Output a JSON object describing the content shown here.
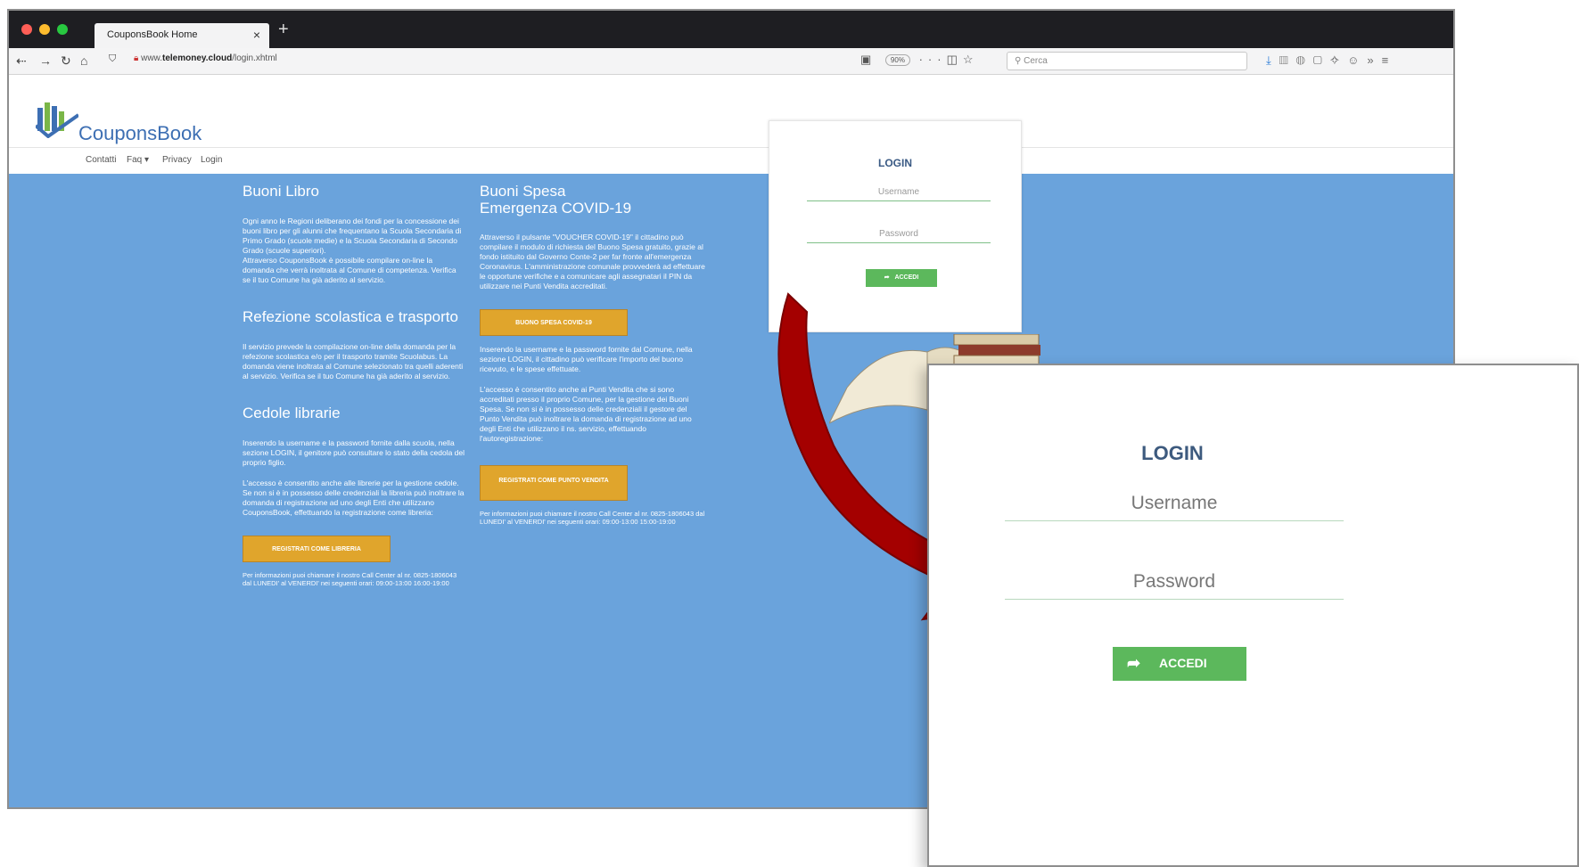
{
  "browser": {
    "tab_title": "CouponsBook Home",
    "tab_close": "×",
    "new_tab": "+",
    "url_prefix": "www.",
    "url_domain": "telemoney.cloud",
    "url_path": "/login.xhtml",
    "zoom": "90%",
    "search_placeholder": "Cerca"
  },
  "site": {
    "logo_text": "CouponsBook",
    "menu": [
      "Contatti",
      "Faq ▾",
      "Privacy",
      "Login"
    ]
  },
  "left_column": {
    "section1_title": "Buoni Libro",
    "section1_text": "Ogni anno le Regioni deliberano dei fondi per la concessione dei buoni libro per gli alunni che frequentano la Scuola Secondaria di Primo Grado (scuole medie) e la Scuola Secondaria di Secondo Grado (scuole superiori).\nAttraverso CouponsBook è possibile compilare on-line la domanda che verrà inoltrata al Comune di competenza. Verifica se il tuo Comune ha già aderito al servizio.",
    "section2_title": "Refezione scolastica e trasporto",
    "section2_text": "Il servizio prevede la compilazione on-line della domanda per la refezione scolastica e/o per il trasporto tramite Scuolabus. La domanda viene inoltrata al Comune selezionato tra quelli aderenti al servizio. Verifica se il tuo Comune ha già aderito al servizio.",
    "section3_title": "Cedole librarie",
    "section3_text1": "Inserendo la username e la password fornite dalla scuola, nella sezione LOGIN, il genitore può consultare lo stato della cedola del proprio figlio.",
    "section3_text2": "L'accesso è consentito anche alle librerie per la gestione cedole. Se non si è in possesso delle credenziali la libreria può inoltrare la domanda di registrazione ad uno degli Enti che utilizzano CouponsBook, effettuando la registrazione come libreria:",
    "button": "REGISTRATI COME LIBRERIA",
    "footer": "Per informazioni puoi chiamare il nostro Call Center al nr. 0825-1806043 dal LUNEDI' al VENERDI' nei seguenti orari: 09:00-13:00 16:00-19:00"
  },
  "right_column": {
    "title_line1": "Buoni Spesa",
    "title_line2": "Emergenza COVID-19",
    "text1": "Attraverso il pulsante \"VOUCHER COVID-19\" il cittadino può compilare il modulo di richiesta del Buono Spesa gratuito, grazie al fondo istituito dal Governo Conte-2 per far fronte all'emergenza Coronavirus. L'amministrazione comunale provvederà ad effettuare le opportune verifiche e a comunicare agli assegnatari il PIN da utilizzare nei Punti Vendita accreditati.",
    "button1": "BUONO SPESA COVID-19",
    "text2": "Inserendo la username e la password fornite dal Comune, nella sezione LOGIN, il cittadino può verificare l'importo del buono ricevuto, e le spese effettuate.",
    "text3": "L'accesso è consentito anche ai Punti Vendita che si sono accreditati presso il proprio Comune, per la gestione dei Buoni Spesa. Se non si è in possesso delle credenziali il gestore del Punto Vendita può inoltrare la domanda di registrazione ad uno degli Enti che utilizzano il ns. servizio, effettuando l'autoregistrazione:",
    "button2": "REGISTRATI COME PUNTO VENDITA",
    "footer": "Per informazioni puoi chiamare il nostro Call Center al nr. 0825-1806043 dal LUNEDI' al VENERDI' nei seguenti orari: 09:00-13:00 15:00-19:00"
  },
  "login": {
    "title": "LOGIN",
    "username_placeholder": "Username",
    "password_placeholder": "Password",
    "button": "ACCEDI"
  },
  "colors": {
    "page_blue": "#6aa3dc",
    "button_yellow": "#e0a52c",
    "login_green": "#5cb85c",
    "arrow_red": "#a40000"
  }
}
